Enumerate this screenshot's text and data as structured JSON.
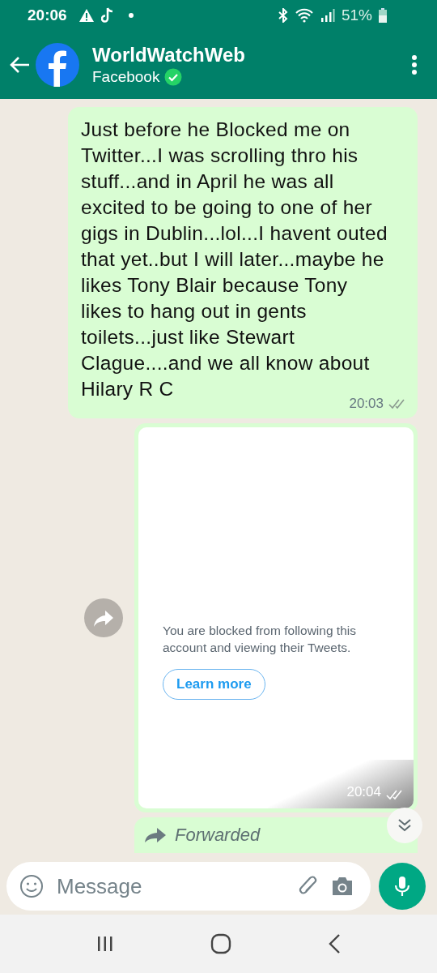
{
  "status_bar": {
    "time": "20:06",
    "battery": "51%"
  },
  "header": {
    "title": "WorldWatchWeb",
    "subtitle": "Facebook",
    "verified": true
  },
  "messages": [
    {
      "kind": "text",
      "text": "Just before he Blocked me on Twitter...I was scrolling thro his stuff...and in April he was all excited to be going to one of her gigs in Dublin...lol...I havent outed that yet..but I will later...maybe he likes Tony Blair because Tony likes to hang out in gents toilets...just like Stewart Clague....and we all know about Hilary R C",
      "time": "20:03"
    },
    {
      "kind": "screenshot",
      "notice": "You are blocked from following this account and viewing their Tweets.",
      "button": "Learn more",
      "time": "20:04"
    },
    {
      "kind": "forwarded",
      "label": "Forwarded"
    }
  ],
  "composer": {
    "placeholder": "Message"
  }
}
